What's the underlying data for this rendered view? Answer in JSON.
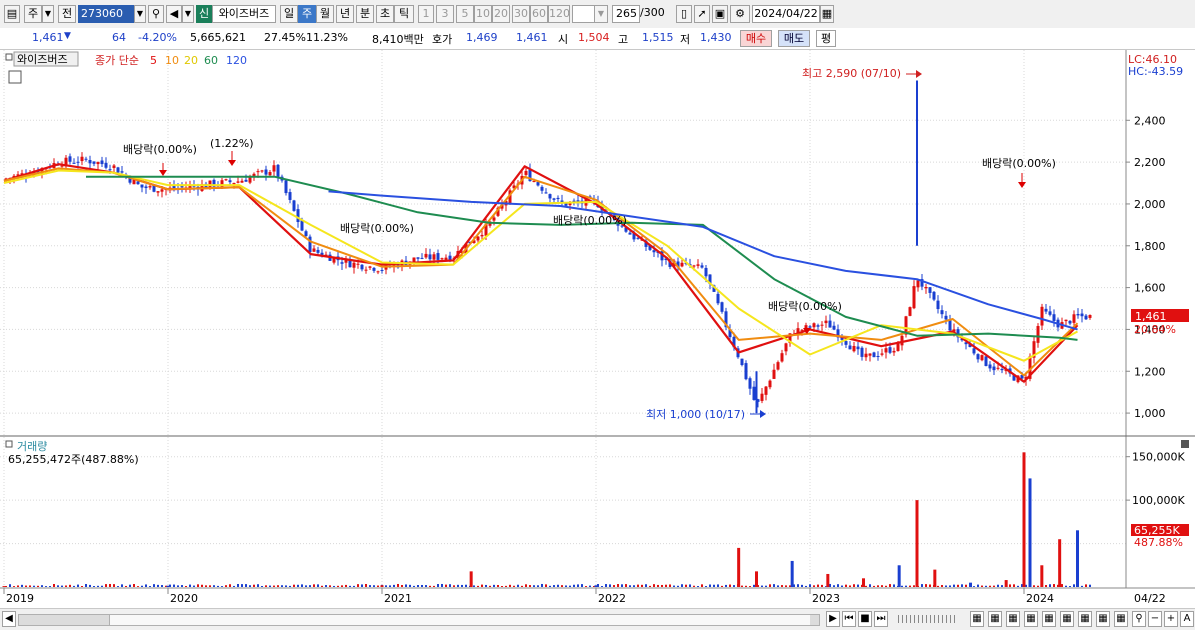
{
  "toolbar": {
    "market_label": "주",
    "prev_label": "전",
    "code": "273060",
    "new_badge": "신",
    "stock_name": "와이즈버즈",
    "period_day": "일",
    "period_week": "주",
    "period_month": "월",
    "period_year": "년",
    "period_minute": "분",
    "period_second": "초",
    "period_tick": "틱",
    "intervals": [
      "1",
      "3",
      "5",
      "10",
      "20",
      "30",
      "60",
      "120"
    ],
    "count_current": "265",
    "count_total": "/300",
    "date": "2024/04/22"
  },
  "quote": {
    "price": "1,461",
    "change": "64",
    "change_pct": "-4.20%",
    "volume": "5,665,621",
    "vol_ratio": "27.45%",
    "turnover": "11.23%",
    "amount": "8,410백만",
    "bid_label": "호가",
    "bid": "1,469",
    "ask": "1,461",
    "open_label": "시",
    "open": "1,504",
    "high_label": "고",
    "high": "1,515",
    "low_label": "저",
    "low": "1,430",
    "buy_label": "매수",
    "sell_label": "매도",
    "eval_label": "평"
  },
  "price_panel": {
    "tag": "와이즈버즈",
    "ma_title": "종가 단순",
    "ma_periods": [
      "5",
      "10",
      "20",
      "60",
      "120"
    ],
    "lc": "LC:46.10",
    "hc": "HC:-43.59",
    "current_price_tag": "1,461",
    "current_change_tag": "20.84%",
    "annotations": {
      "div1": "배당락(0.00%)",
      "split": "(1.22%)",
      "div2": "배당락(0.00%)",
      "div3": "배당락(0.00%)",
      "div4": "배당락(0.00%)",
      "div5": "배당락(0.00%)",
      "high": "최고 2,590 (07/10)",
      "low": "최저 1,000 (10/17)"
    }
  },
  "volume_panel": {
    "title": "거래량",
    "summary": "65,255,472주(487.88%)",
    "current_tag": "65,255K",
    "current_pct": "487.88%"
  },
  "x_axis": {
    "labels": [
      "2019",
      "2020",
      "2021",
      "2022",
      "2023",
      "2024"
    ],
    "right_label": "04/22"
  },
  "colors": {
    "up": "#e01010",
    "down": "#1a3fd0",
    "ma5": "#e01010",
    "ma10": "#f08c10",
    "ma20": "#f5e61e",
    "ma60": "#1e8c50",
    "ma120": "#2a50e0"
  },
  "chart_data": [
    {
      "type": "candlestick",
      "title": "와이즈버즈",
      "x_range": [
        "2019-01",
        "2024-04-22"
      ],
      "x_tick_labels": [
        "2019",
        "2020",
        "2021",
        "2022",
        "2023",
        "2024"
      ],
      "ylim": [
        900,
        2650
      ],
      "y_ticks": [
        1000,
        1200,
        1400,
        1600,
        1800,
        2000,
        2200,
        2400
      ],
      "y_tick_labels": [
        "1,000",
        "1,200",
        "1,400",
        "1,600",
        "1,800",
        "2,000",
        "2,200",
        "2,400"
      ],
      "grid": true,
      "legend": "top-left",
      "series": [
        {
          "name": "close",
          "x": [
            "2019-01",
            "2019-03",
            "2019-05",
            "2019-07",
            "2019-09",
            "2019-11",
            "2020-01",
            "2020-03",
            "2020-05",
            "2020-07",
            "2020-09",
            "2020-11",
            "2021-01",
            "2021-03",
            "2021-05",
            "2021-07",
            "2021-09",
            "2021-11",
            "2022-01",
            "2022-03",
            "2022-05",
            "2022-07",
            "2022-09",
            "2022-10",
            "2022-12",
            "2023-02",
            "2023-04",
            "2023-06",
            "2023-07",
            "2023-09",
            "2023-11",
            "2024-01",
            "2024-02",
            "2024-03",
            "2024-04"
          ],
          "values": [
            2120,
            2150,
            2200,
            2210,
            2180,
            2080,
            2070,
            2090,
            2110,
            2170,
            1780,
            1720,
            1690,
            1740,
            1750,
            1900,
            2150,
            2000,
            2010,
            1850,
            1720,
            1690,
            1270,
            1030,
            1390,
            1430,
            1260,
            1320,
            1650,
            1390,
            1230,
            1150,
            1490,
            1420,
            1461
          ]
        },
        {
          "name": "5",
          "x": [
            "2019-01",
            "2019-05",
            "2019-09",
            "2020-01",
            "2020-05",
            "2020-09",
            "2021-01",
            "2021-05",
            "2021-09",
            "2022-01",
            "2022-05",
            "2022-09",
            "2023-01",
            "2023-05",
            "2023-09",
            "2024-01",
            "2024-04"
          ],
          "values": [
            2110,
            2190,
            2150,
            2070,
            2080,
            1760,
            1710,
            1730,
            2180,
            2000,
            1740,
            1290,
            1400,
            1320,
            1390,
            1150,
            1420
          ]
        },
        {
          "name": "10",
          "x": [
            "2019-01",
            "2019-05",
            "2019-09",
            "2020-01",
            "2020-05",
            "2020-09",
            "2021-01",
            "2021-05",
            "2021-09",
            "2022-01",
            "2022-05",
            "2022-09",
            "2023-01",
            "2023-05",
            "2023-09",
            "2024-01",
            "2024-04"
          ],
          "values": [
            2110,
            2170,
            2150,
            2070,
            2080,
            1820,
            1700,
            1710,
            2130,
            2020,
            1760,
            1350,
            1380,
            1350,
            1450,
            1180,
            1430
          ]
        },
        {
          "name": "20",
          "x": [
            "2019-01",
            "2019-05",
            "2019-09",
            "2020-01",
            "2020-05",
            "2020-09",
            "2021-01",
            "2021-05",
            "2021-09",
            "2022-01",
            "2022-05",
            "2022-09",
            "2023-01",
            "2023-05",
            "2023-09",
            "2024-01",
            "2024-04"
          ],
          "values": [
            2100,
            2160,
            2150,
            2090,
            2090,
            1900,
            1720,
            1710,
            2000,
            2010,
            1800,
            1500,
            1280,
            1420,
            1380,
            1250,
            1390
          ]
        },
        {
          "name": "60",
          "x": [
            "2019-07",
            "2019-11",
            "2020-03",
            "2020-07",
            "2020-11",
            "2021-03",
            "2021-07",
            "2021-11",
            "2022-03",
            "2022-07",
            "2022-11",
            "2023-03",
            "2023-07",
            "2023-11",
            "2024-03",
            "2024-04"
          ],
          "values": [
            2130,
            2130,
            2130,
            2130,
            2050,
            1960,
            1910,
            1900,
            1910,
            1900,
            1640,
            1460,
            1370,
            1380,
            1360,
            1350
          ]
        },
        {
          "name": "120",
          "x": [
            "2020-10",
            "2021-01",
            "2021-06",
            "2021-11",
            "2022-03",
            "2022-07",
            "2022-11",
            "2023-03",
            "2023-07",
            "2023-11",
            "2024-02",
            "2024-04"
          ],
          "values": [
            2060,
            2040,
            2010,
            1990,
            1940,
            1890,
            1750,
            1680,
            1640,
            1520,
            1450,
            1400
          ]
        }
      ],
      "markers": [
        {
          "label": "최고 2,590 (07/10)",
          "x": "2023-07",
          "y": 2590
        },
        {
          "label": "최저 1,000 (10/17)",
          "x": "2022-10",
          "y": 1000
        }
      ]
    },
    {
      "type": "bar",
      "title": "거래량",
      "ylim": [
        0,
        160000
      ],
      "y_ticks": [
        50000,
        100000,
        150000
      ],
      "y_tick_labels": [
        "100,000K",
        "150,000K"
      ],
      "x": [
        "2019",
        "2020",
        "2021",
        "2021-06",
        "2022",
        "2022-09",
        "2022-10",
        "2022-12",
        "2023-02",
        "2023-04",
        "2023-06",
        "2023-07",
        "2023-08",
        "2023-10",
        "2023-12",
        "2024-01",
        "2024-01b",
        "2024-02",
        "2024-03",
        "2024-04"
      ],
      "values": [
        1000,
        1500,
        2000,
        18000,
        2000,
        45000,
        18000,
        30000,
        15000,
        10000,
        25000,
        100000,
        20000,
        5000,
        8000,
        155000,
        125000,
        25000,
        55000,
        65255
      ]
    }
  ]
}
